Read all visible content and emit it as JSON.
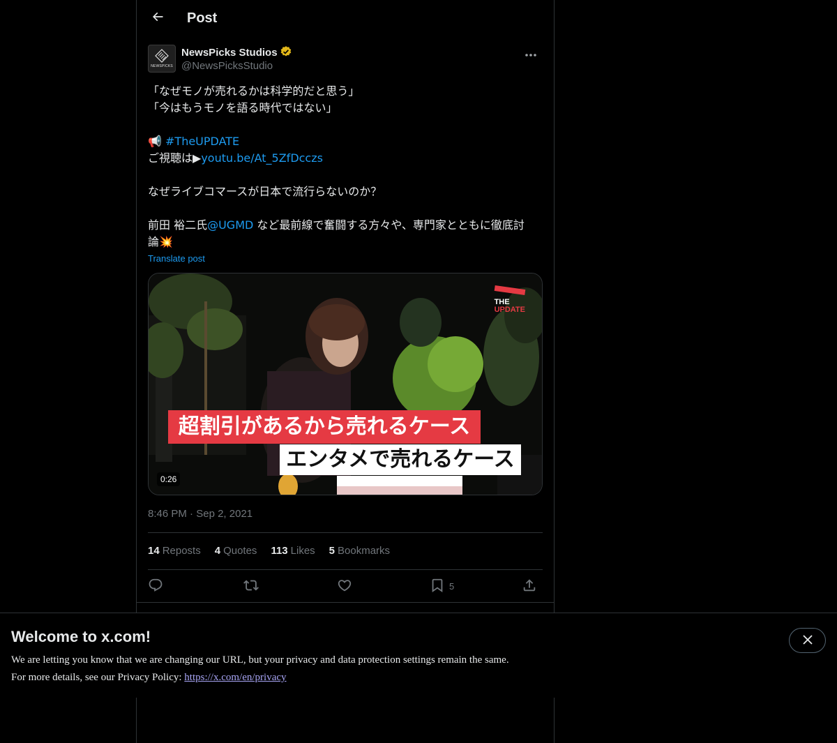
{
  "header": {
    "title": "Post"
  },
  "post": {
    "author": {
      "display_name": "NewsPicks Studios",
      "handle": "@NewsPicksStudio",
      "avatar_text": "NEWSPICKS",
      "verified_color": "#e2b719"
    },
    "body": {
      "line1": "「なぜモノが売れるかは科学的だと思う」",
      "line2": "「今はもうモノを語る時代ではない」",
      "hashtag_emoji": "📢",
      "hashtag": "#TheUPDATE",
      "watch_prefix": "ご視聴は▶",
      "watch_link": "youtu.be/At_5ZfDcczs",
      "question": "なぜライブコマースが日本で流行らないのか？",
      "mention_prefix": "前田 裕二氏",
      "mention": "@UGMD",
      "mention_suffix": " など最前線で奮闘する方々や、専門家とともに徹底討",
      "last_line": "論",
      "last_emoji": "💥"
    },
    "translate_label": "Translate post",
    "media": {
      "duration": "0:26",
      "caption_red": "超割引があるから売れるケース",
      "caption_white": "エンタメで売れるケース",
      "brand_line1": "THE",
      "brand_line2": "UPDATE"
    },
    "time": "8:46 PM",
    "separator": "·",
    "date": "Sep 2, 2021",
    "stats": {
      "reposts_count": "14",
      "reposts_label": "Reposts",
      "quotes_count": "4",
      "quotes_label": "Quotes",
      "likes_count": "113",
      "likes_label": "Likes",
      "bookmarks_count": "5",
      "bookmarks_label": "Bookmarks"
    },
    "actions": {
      "bookmark_count": "5"
    }
  },
  "banner": {
    "title": "Welcome to x.com!",
    "line1": "We are letting you know that we are changing our URL, but your privacy and data protection settings remain the same.",
    "line2_prefix": "For more details, see our Privacy Policy: ",
    "link": "https://x.com/en/privacy"
  },
  "colors": {
    "background": "#000000",
    "text": "#e7e9ea",
    "muted": "#71767b",
    "link": "#1d9bf0",
    "border": "#2f3336",
    "caption_red": "#e53a43"
  }
}
